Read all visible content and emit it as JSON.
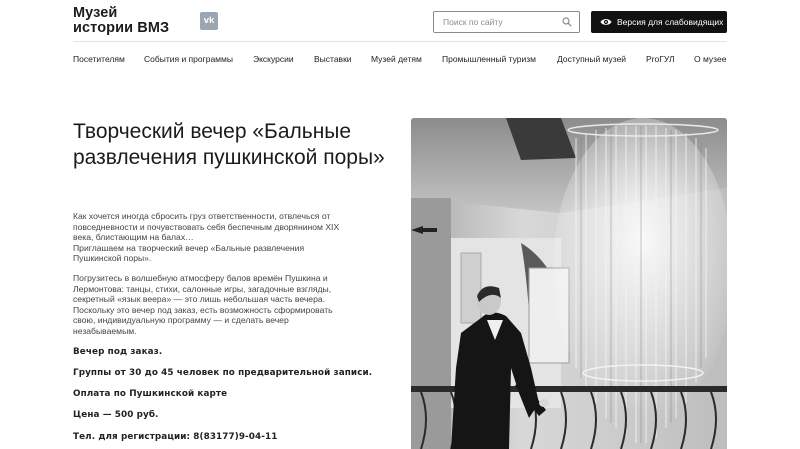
{
  "header": {
    "logo_line1": "Музей",
    "logo_line2": "истории ВМЗ",
    "vk_label": "vk",
    "search_placeholder": "Поиск по сайту",
    "vision_button": "Версия для слабовидящих"
  },
  "nav": [
    "Посетителям",
    "События и программы",
    "Экскурсии",
    "Выставки",
    "Музей детям",
    "Промышленный туризм",
    "Доступный музей",
    "ProГУЛ",
    "О музее"
  ],
  "article": {
    "title": "Творческий вечер «Бальные развлечения пушкинской поры»",
    "p1_line1": "Как хочется иногда сбросить груз ответственности, отвлечься от",
    "p1_line2": "повседневности и почувствовать себя беспечным дворянином XIX",
    "p1_line3": "века, блистающим на балах…",
    "p1_line4": "Приглашаем на творческий вечер «Бальные развлечения",
    "p1_line5": "Пушкинской поры».",
    "p2_line1": "Погрузитесь в волшебную атмосферу балов времён Пушкина и",
    "p2_line2": "Лермонтова: танцы, стихи, салонные игры, загадочные взгляды,",
    "p2_line3": "секретный «язык веера» — это лишь небольшая часть вечера.",
    "p2_line4": "Поскольку это вечер под заказ, есть возможность сформировать",
    "p2_line5": "свою, индивидуальную программу — и сделать вечер",
    "p2_line6": "незабываемым.",
    "order": "Вечер под заказ.",
    "groups": "Группы от 30 до 45 человек по предварительной записи.",
    "pushkin_card": "Оплата по Пушкинской карте",
    "price": "Цена — 500 руб.",
    "phone": "Тел. для регистрации: 8(83177)9-04-11"
  },
  "colors": {
    "accent_dark": "#111111",
    "vk_gray": "#9aa6b1",
    "text_body": "#444444"
  }
}
